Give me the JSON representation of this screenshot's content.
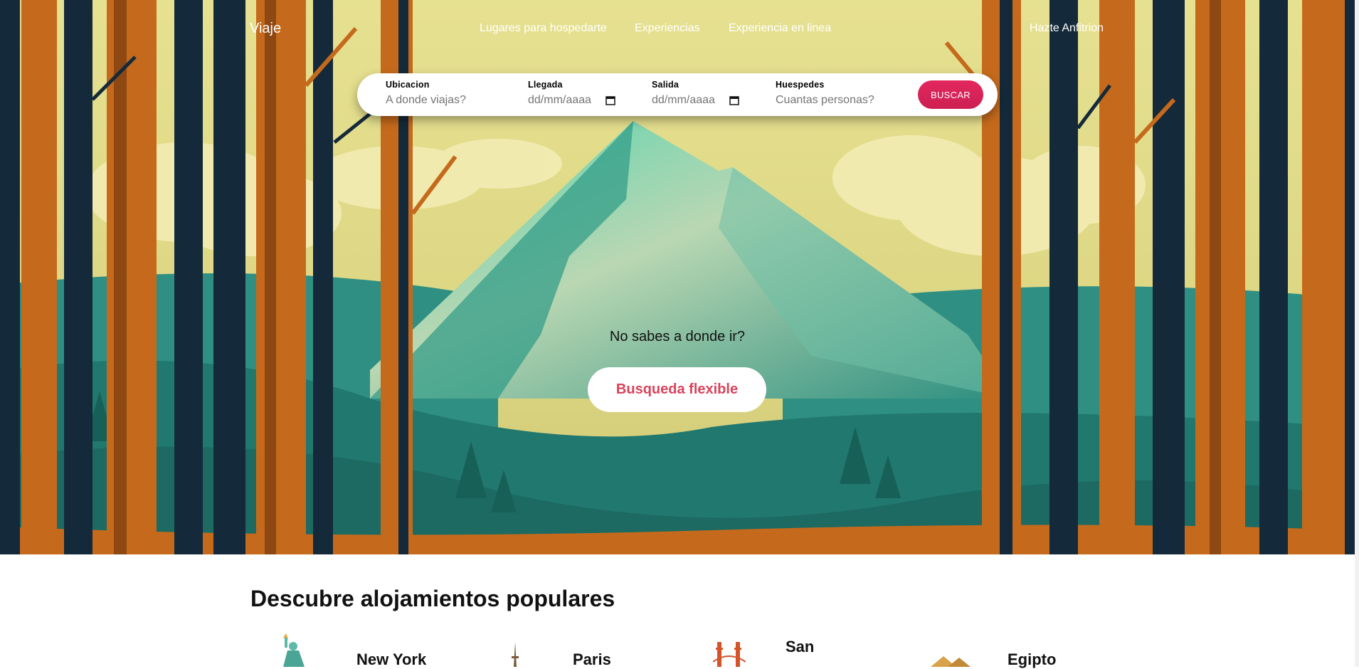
{
  "nav": {
    "brand": "Viaje",
    "links": [
      "Lugares para hospedarte",
      "Experiencias",
      "Experiencia en linea"
    ],
    "host": "Hazte Anfitrion"
  },
  "search": {
    "location_label": "Ubicacion",
    "location_placeholder": "A donde viajas?",
    "checkin_label": "Llegada",
    "checkin_placeholder": "dd/mm/aaaa",
    "checkout_label": "Salida",
    "checkout_placeholder": "dd/mm/aaaa",
    "guests_label": "Huespedes",
    "guests_placeholder": "Cuantas personas?",
    "button": "BUSCAR"
  },
  "hero": {
    "question": "No sabes a donde ir?",
    "flexible_button": "Busqueda flexible"
  },
  "popular": {
    "title": "Descubre alojamientos populares",
    "destinations": [
      {
        "name": "New York",
        "icon": "statue-of-liberty-icon"
      },
      {
        "name": "Paris",
        "icon": "eiffel-tower-icon"
      },
      {
        "name": "San",
        "icon": "golden-gate-bridge-icon"
      },
      {
        "name": "Egipto",
        "icon": "pyramids-icon"
      }
    ]
  },
  "colors": {
    "accent": "#e3285e",
    "flexible_text": "#d9435b",
    "sky": "#e2dd8c",
    "mountain": "#2f9c8a",
    "trunk_orange": "#c56a1c",
    "trunk_dark": "#142a3a"
  }
}
